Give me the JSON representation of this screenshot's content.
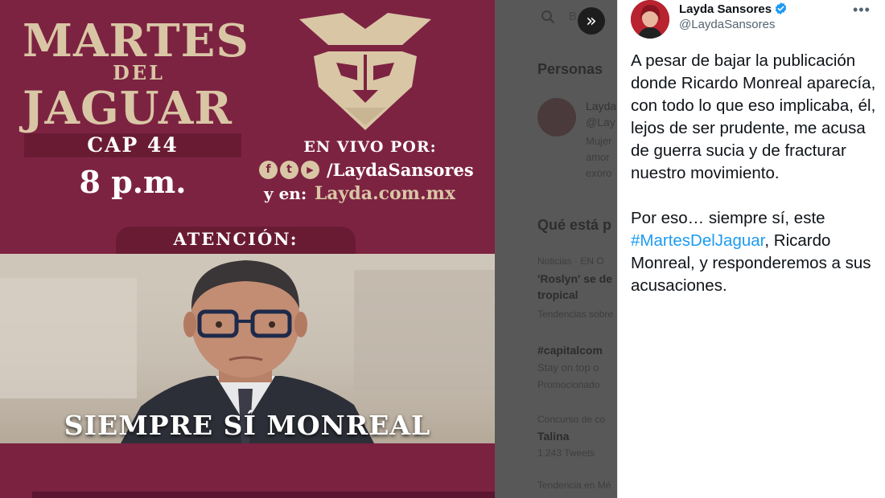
{
  "media": {
    "title_martes": "MARTES",
    "title_del": "DEL",
    "title_jaguar": "JAGUAR",
    "episode": "CAP 44",
    "time": "8 p.m.",
    "live_label": "EN VIVO POR:",
    "social_icons": [
      "f",
      "t",
      "▶"
    ],
    "handle": "/LaydaSansores",
    "also_label": "y en:",
    "website": "Layda.com.mx",
    "attention": "ATENCIÓN:",
    "caption": "SIEMPRE SÍ MONREAL"
  },
  "background_page": {
    "search_placeholder": "B",
    "who_to_follow": "Personas",
    "suggest_name": "Layda",
    "suggest_handle": "@Lay",
    "suggest_bio_1": "Mujer",
    "suggest_bio_2": "amor",
    "suggest_bio_3": "exoro",
    "trending_title": "Qué está p",
    "trend_1_meta": "Noticias · EN O",
    "trend_1_title_a": "'Roslyn' se de",
    "trend_1_title_b": "tropical",
    "trend_1_sub": "Tendencias sobre",
    "trend_2_title": "#capitalcom",
    "trend_2_sub": "Stay on top o",
    "trend_2_promo": "Promocionado",
    "trend_3_meta": "Concurso de co",
    "trend_3_title": "Talina",
    "trend_3_count": "1.243 Tweets",
    "trend_4_meta": "Tendencia en Mé"
  },
  "tweet": {
    "display_name": "Layda Sansores",
    "username": "@LaydaSansores",
    "more_label": "•••",
    "paragraph_1": "A pesar de bajar la publicación donde Ricardo Monreal aparecía, con todo lo que eso implicaba, él, lejos de ser prudente, me acusa de guerra sucia y de fracturar nuestro movimiento.",
    "paragraph_2_prefix": "Por eso… siempre sí, este",
    "hashtag": "#MartesDelJaguar",
    "paragraph_2_suffix": ", Ricardo Monreal, y responderemos a sus acusaciones."
  },
  "controls": {
    "expand_label": "»"
  },
  "colors": {
    "brand_maroon": "#7d2342",
    "gold": "#d9c6a5",
    "link_blue": "#1d9bf0",
    "verified_blue": "#1d9bf0"
  }
}
